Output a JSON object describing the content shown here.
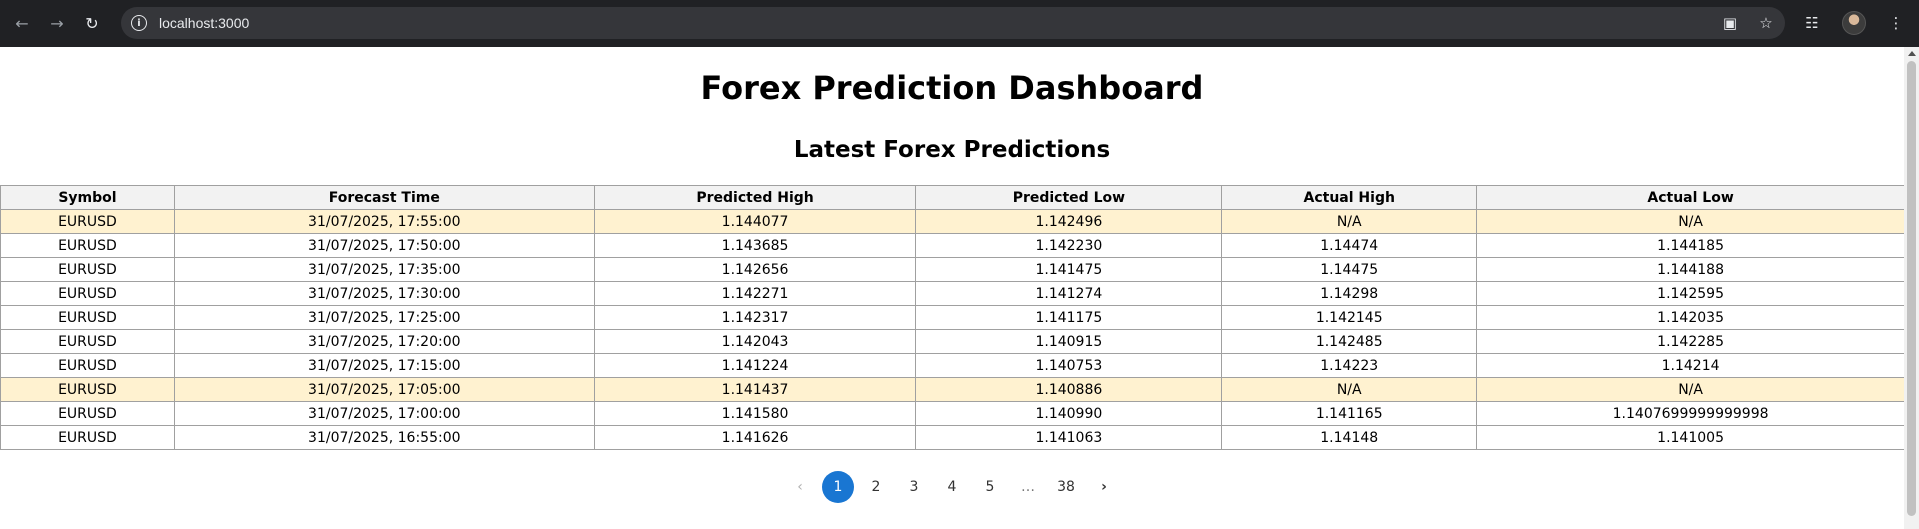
{
  "browser": {
    "url": "localhost:3000",
    "back_icon": "arrow-left-icon",
    "forward_icon": "arrow-right-icon",
    "reload_icon": "reload-icon",
    "info_icon": "info-icon",
    "install_icon": "install-app-icon",
    "star_icon": "star-icon",
    "extensions_icon": "puzzle-icon",
    "menu_icon": "kebab-menu-icon"
  },
  "page": {
    "title": "Forex Prediction Dashboard",
    "subtitle": "Latest Forex Predictions"
  },
  "table": {
    "headers": [
      "Symbol",
      "Forecast Time",
      "Predicted High",
      "Predicted Low",
      "Actual High",
      "Actual Low"
    ],
    "rows": [
      {
        "symbol": "EURUSD",
        "time": "31/07/2025, 17:55:00",
        "pred_high": "1.144077",
        "pred_low": "1.142496",
        "act_high": "N/A",
        "act_low": "N/A",
        "pending": true
      },
      {
        "symbol": "EURUSD",
        "time": "31/07/2025, 17:50:00",
        "pred_high": "1.143685",
        "pred_low": "1.142230",
        "act_high": "1.14474",
        "act_low": "1.144185",
        "pending": false
      },
      {
        "symbol": "EURUSD",
        "time": "31/07/2025, 17:35:00",
        "pred_high": "1.142656",
        "pred_low": "1.141475",
        "act_high": "1.14475",
        "act_low": "1.144188",
        "pending": false
      },
      {
        "symbol": "EURUSD",
        "time": "31/07/2025, 17:30:00",
        "pred_high": "1.142271",
        "pred_low": "1.141274",
        "act_high": "1.14298",
        "act_low": "1.142595",
        "pending": false
      },
      {
        "symbol": "EURUSD",
        "time": "31/07/2025, 17:25:00",
        "pred_high": "1.142317",
        "pred_low": "1.141175",
        "act_high": "1.142145",
        "act_low": "1.142035",
        "pending": false
      },
      {
        "symbol": "EURUSD",
        "time": "31/07/2025, 17:20:00",
        "pred_high": "1.142043",
        "pred_low": "1.140915",
        "act_high": "1.142485",
        "act_low": "1.142285",
        "pending": false
      },
      {
        "symbol": "EURUSD",
        "time": "31/07/2025, 17:15:00",
        "pred_high": "1.141224",
        "pred_low": "1.140753",
        "act_high": "1.14223",
        "act_low": "1.14214",
        "pending": false
      },
      {
        "symbol": "EURUSD",
        "time": "31/07/2025, 17:05:00",
        "pred_high": "1.141437",
        "pred_low": "1.140886",
        "act_high": "N/A",
        "act_low": "N/A",
        "pending": true
      },
      {
        "symbol": "EURUSD",
        "time": "31/07/2025, 17:00:00",
        "pred_high": "1.141580",
        "pred_low": "1.140990",
        "act_high": "1.141165",
        "act_low": "1.1407699999999998",
        "pending": false
      },
      {
        "symbol": "EURUSD",
        "time": "31/07/2025, 16:55:00",
        "pred_high": "1.141626",
        "pred_low": "1.141063",
        "act_high": "1.14148",
        "act_low": "1.141005",
        "pending": false
      }
    ],
    "highlight_color": "#fff2d0"
  },
  "pagination": {
    "prev_icon": "chevron-left-icon",
    "next_icon": "chevron-right-icon",
    "pages": [
      "1",
      "2",
      "3",
      "4",
      "5"
    ],
    "ellipsis": "…",
    "last_page": "38",
    "current_page": "1",
    "accent_color": "#1976d2"
  }
}
